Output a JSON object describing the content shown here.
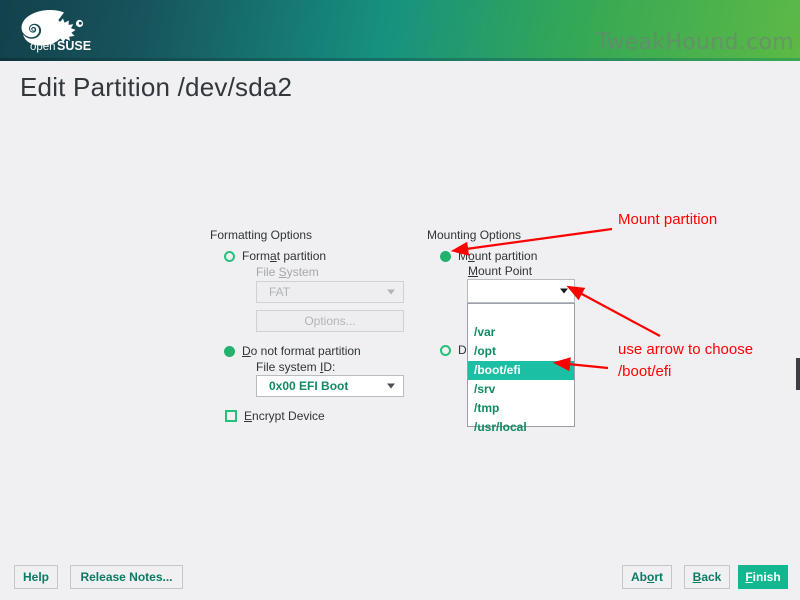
{
  "header": {
    "logo_name": "opensuse-chameleon-logo",
    "logo_text_open": "open",
    "logo_text_suse": "SUSE",
    "watermark": "TweakHound.com"
  },
  "page": {
    "title": "Edit Partition /dev/sda2"
  },
  "formatting": {
    "group_title": "Formatting Options",
    "format_radio": {
      "label_pre": "Form",
      "label_mnemonic": "a",
      "label_post": "t partition",
      "selected": false
    },
    "file_system_label_pre": "File ",
    "file_system_label_mnemonic": "S",
    "file_system_label_post": "ystem",
    "file_system_value": "FAT",
    "options_button": "Options...",
    "do_not_format_radio": {
      "label_pre": "",
      "label_mnemonic": "D",
      "label_post": "o not format partition",
      "selected": true
    },
    "fsid_label_pre": "File system ",
    "fsid_label_mnemonic": "I",
    "fsid_label_post": "D:",
    "fsid_value": "0x00 EFI Boot",
    "encrypt_label_pre": "",
    "encrypt_label_mnemonic": "E",
    "encrypt_label_post": "ncrypt Device",
    "encrypt_checked": false
  },
  "mounting": {
    "group_title": "Mounting Options",
    "mount_radio": {
      "label_pre": "M",
      "label_mnemonic": "o",
      "label_post": "unt partition",
      "selected": true
    },
    "mount_point_label_mnemonic": "M",
    "mount_point_label_post": "ount Point",
    "mount_point_value": "",
    "do_not_mount_radio": {
      "label_visible": "Do",
      "selected": false
    },
    "dropdown_open": true,
    "dropdown_items": [
      {
        "label": "",
        "selected": false
      },
      {
        "label": "/var",
        "selected": false
      },
      {
        "label": "/opt",
        "selected": false
      },
      {
        "label": "/boot/efi",
        "selected": true
      },
      {
        "label": "/srv",
        "selected": false
      },
      {
        "label": "/tmp",
        "selected": false
      },
      {
        "label": "/usr/local",
        "selected": false
      }
    ]
  },
  "annotations": {
    "mount_partition": "Mount partition",
    "use_arrow_line1": "use arrow to choose",
    "use_arrow_line2": "/boot/efi",
    "color": "#ff0000"
  },
  "footer": {
    "help_label": "Help",
    "release_notes_label": "Release Notes...",
    "abort_pre": "Ab",
    "abort_mnemonic": "o",
    "abort_post": "rt",
    "back_pre": "",
    "back_mnemonic": "B",
    "back_post": "ack",
    "finish_pre": "",
    "finish_mnemonic": "F",
    "finish_post": "inish"
  },
  "colors": {
    "accent_teal": "#12b68f",
    "accent_green": "#23b26d",
    "text_green": "#0f8a62",
    "highlight": "#1bbfa3",
    "background": "#f0f0f2",
    "annotation_red": "#ff0000"
  }
}
